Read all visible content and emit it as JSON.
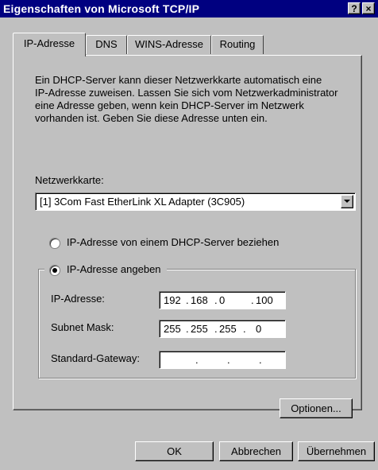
{
  "window": {
    "title": "Eigenschaften von Microsoft TCP/IP",
    "help_label": "?",
    "close_label": "×"
  },
  "tabs": [
    {
      "label": "IP-Adresse",
      "active": true
    },
    {
      "label": "DNS",
      "active": false
    },
    {
      "label": "WINS-Adresse",
      "active": false
    },
    {
      "label": "Routing",
      "active": false
    }
  ],
  "description": [
    "Ein DHCP-Server kann dieser Netzwerkkarte automatisch eine",
    "IP-Adresse zuweisen. Lassen Sie sich vom Netzwerkadministrator",
    "eine Adresse geben, wenn kein DHCP-Server im Netzwerk",
    "vorhanden ist. Geben Sie diese Adresse unten ein."
  ],
  "adapter": {
    "label": "Netzwerkkarte:",
    "selected": "[1] 3Com Fast EtherLink XL Adapter (3C905)"
  },
  "mode": {
    "dhcp_label": "IP-Adresse von einem DHCP-Server beziehen",
    "dhcp_checked": false,
    "manual_label": "IP-Adresse angeben",
    "manual_checked": true
  },
  "fields": {
    "ip": {
      "label": "IP-Adresse:",
      "octets": [
        "192",
        "168",
        "0",
        "100"
      ]
    },
    "mask": {
      "label": "Subnet Mask:",
      "octets": [
        "255",
        "255",
        "255",
        "0"
      ]
    },
    "gateway": {
      "label": "Standard-Gateway:",
      "octets": [
        "",
        "",
        "",
        ""
      ]
    }
  },
  "buttons": {
    "options": "Optionen...",
    "ok": "OK",
    "cancel": "Abbrechen",
    "apply": "Übernehmen"
  }
}
